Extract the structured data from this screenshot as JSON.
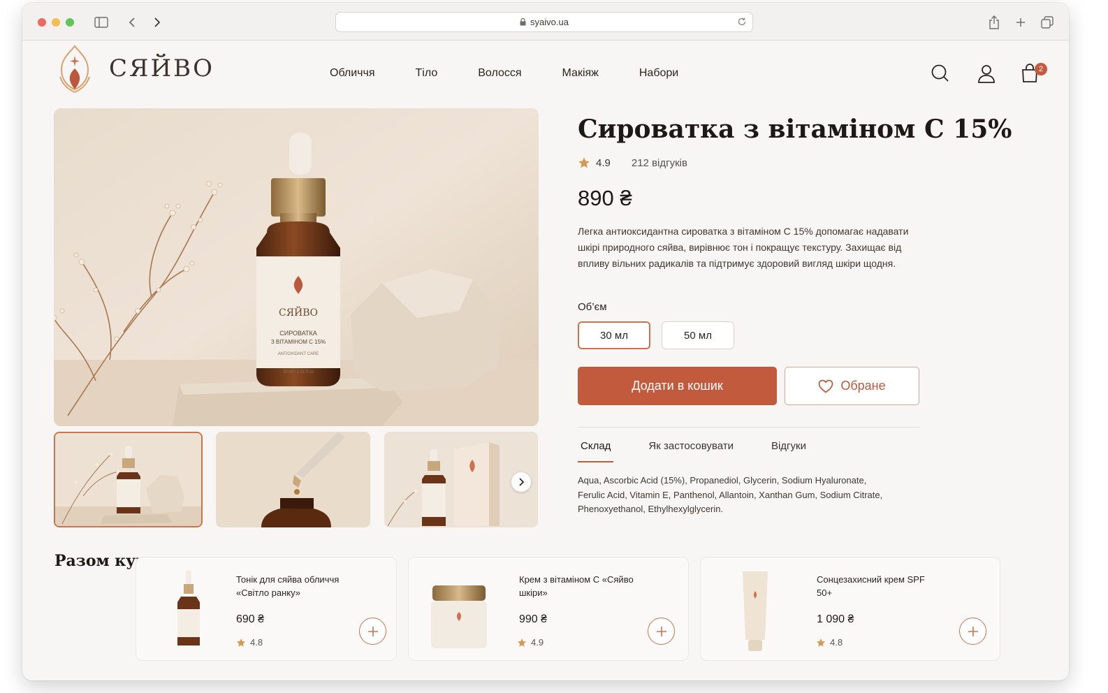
{
  "browser": {
    "url": "syaivo.ua"
  },
  "header": {
    "brand": "СЯЙВО",
    "nav": [
      "Обличчя",
      "Тіло",
      "Волосся",
      "Макіяж",
      "Набори"
    ],
    "cart_count": "2"
  },
  "product": {
    "title": "Сироватка з вітаміном С 15%",
    "rating": "4.9",
    "reviews": "212 відгуків",
    "price": "890 ₴",
    "description": "Легка антиоксидантна сироватка з вітаміном С 15% допомагає надавати шкірі природного сяйва, вирівнює тон і покращує текстуру. Захищає від впливу вільних радикалів та підтримує здоровий вигляд шкіри щодня.",
    "volume_label": "Об’єм",
    "volumes": [
      "30 мл",
      "50 мл"
    ],
    "selected_volume": "30 мл",
    "add_to_cart": "Додати в кошик",
    "favorite": "Обране",
    "tabs": [
      "Склад",
      "Як застосовувати",
      "Відгуки"
    ],
    "active_tab": "Склад",
    "ingredients": "Aqua, Ascorbic Acid (15%), Propanediol, Glycerin, Sodium Hyaluronate, Ferulic Acid, Vitamin E, Panthenol, Allantoin, Xanthan Gum, Sodium Citrate, Phenoxyethanol, Ethylhexylglycerin.",
    "bottle_label": {
      "brand": "СЯЙВО",
      "line1": "СИРОВАТКА",
      "line2": "З ВІТАМІНОМ С 15%",
      "line3": "ANTIOXIDANT CARE",
      "line4": "30 ml / 1.01 fl.oz"
    }
  },
  "together": {
    "title": "Разом купують",
    "items": [
      {
        "name": "Тонік для сяйва обличчя «Світло ранку»",
        "price": "690 ₴",
        "rating": "4.8"
      },
      {
        "name": "Крем з вітаміном С «Сяйво шкіри»",
        "price": "990 ₴",
        "rating": "4.9"
      },
      {
        "name": "Сонцезахисний крем SPF 50+",
        "price": "1 090 ₴",
        "rating": "4.8"
      }
    ]
  },
  "colors": {
    "accent": "#c25a3d",
    "background": "#f8f6f4",
    "gold": "#c9a77c"
  }
}
